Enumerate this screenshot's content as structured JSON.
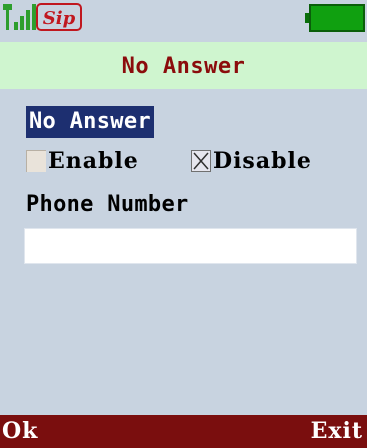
{
  "status_bar": {
    "signal_icon": "signal-strength-icon",
    "sip_icon": "sip-registered-icon",
    "sip_label": "Sip",
    "battery_icon": "battery-full-icon",
    "colors": {
      "signal": "#2d9e2d",
      "sip": "#c0171f",
      "battery": "#10a010"
    }
  },
  "title_bar": {
    "title": "No Answer",
    "color": "#8b0c0c",
    "background": "#cff5cf"
  },
  "content": {
    "section_label": "No Answer",
    "options": [
      {
        "label": "Enable",
        "checked": false
      },
      {
        "label": "Disable",
        "checked": true
      }
    ],
    "phone_number_label": "Phone Number",
    "phone_number_value": "",
    "phone_number_placeholder": ""
  },
  "softkeys": {
    "left": "Ok",
    "right": "Exit",
    "background": "#7a0e0e"
  }
}
